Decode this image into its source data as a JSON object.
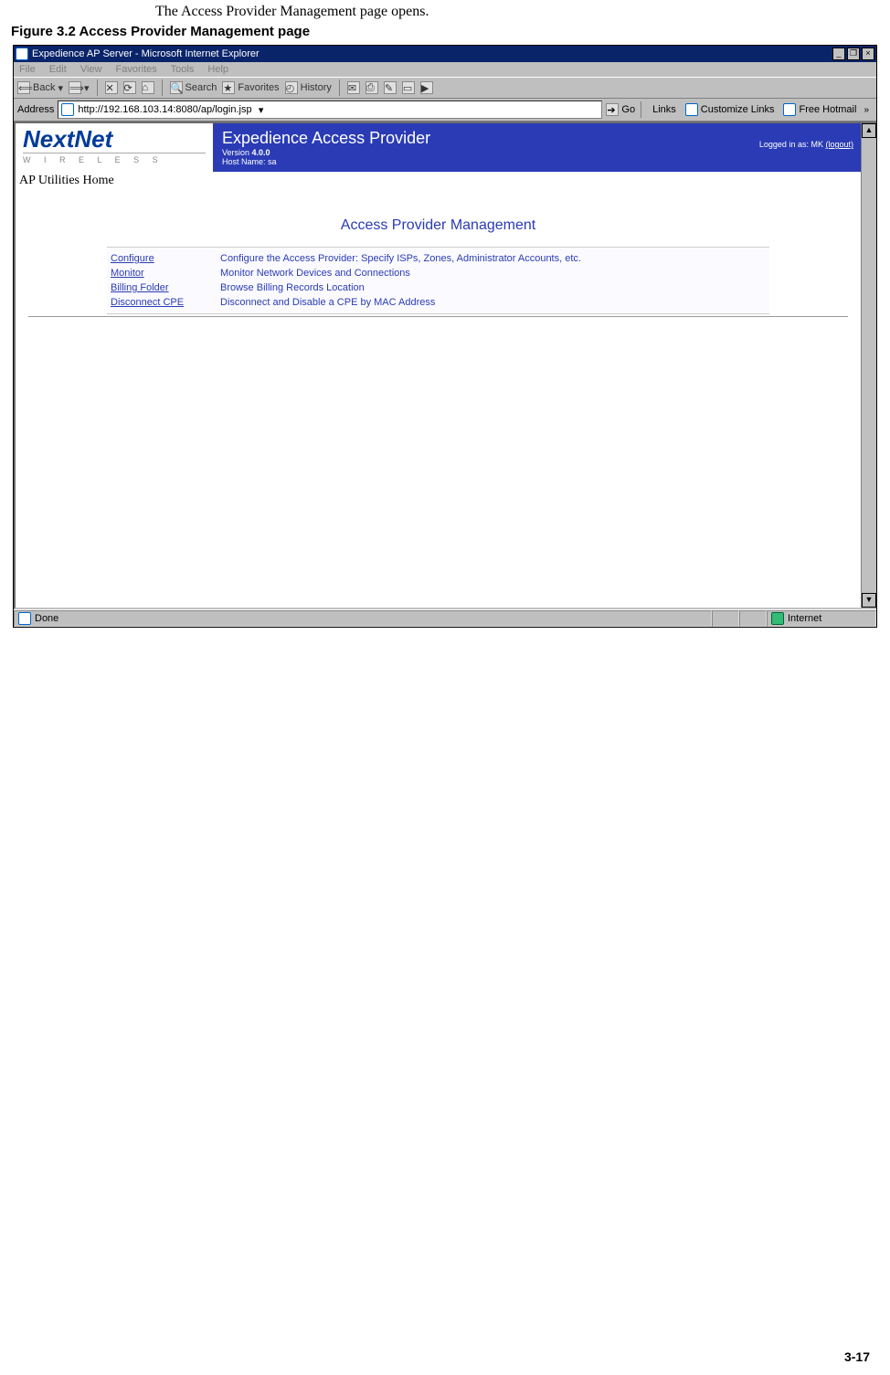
{
  "doc": {
    "caption": "The Access Provider Management page opens.",
    "figure_label": "Figure 3.2   Access Provider Management page",
    "page_number": "3-17"
  },
  "ie": {
    "title": "Expedience AP Server - Microsoft Internet Explorer",
    "window_buttons": {
      "min": "_",
      "max": "❐",
      "close": "×"
    },
    "menu": {
      "file": "File",
      "edit": "Edit",
      "view": "View",
      "favorites": "Favorites",
      "tools": "Tools",
      "help": "Help"
    },
    "toolbar": {
      "back": "Back",
      "search": "Search",
      "favorites": "Favorites",
      "history": "History"
    },
    "address_label": "Address",
    "url": "http://192.168.103.14:8080/ap/login.jsp",
    "go": "Go",
    "links_label": "Links",
    "links": {
      "customize": "Customize Links",
      "hotmail": "Free Hotmail"
    },
    "chevron": "»",
    "status_done": "Done",
    "status_zone": "Internet"
  },
  "app": {
    "logo_top": "NextNet",
    "logo_bottom": "W I R E L E S S",
    "header_title": "Expedience Access Provider",
    "version_label": "Version ",
    "version": "4.0.0",
    "host_label": "Host Name: sa",
    "logged_in": "Logged in as:",
    "user": "MK",
    "logout": "(logout)",
    "home": "AP Utilities Home",
    "section_title": "Access Provider Management",
    "links": [
      {
        "label": "Configure",
        "desc": "Configure the Access Provider: Specify ISPs, Zones, Administrator Accounts, etc."
      },
      {
        "label": "Monitor",
        "desc": "Monitor Network Devices and Connections"
      },
      {
        "label": "Billing Folder",
        "desc": "Browse Billing Records Location"
      },
      {
        "label": "Disconnect CPE",
        "desc": "Disconnect and Disable a CPE by MAC Address"
      }
    ]
  }
}
